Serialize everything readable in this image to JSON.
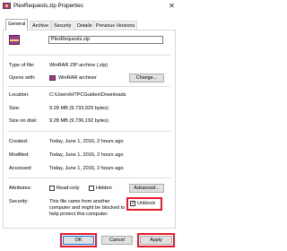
{
  "window": {
    "title": "PlexRequests.zip Properties",
    "close_symbol": "✕"
  },
  "tabs": [
    {
      "label": "General",
      "active": true
    },
    {
      "label": "Archive"
    },
    {
      "label": "Security"
    },
    {
      "label": "Details"
    },
    {
      "label": "Previous Versions"
    }
  ],
  "general": {
    "file_name": "PlexRequests.zip",
    "type_label": "Type of file:",
    "type_value": "WinRAR ZIP archive (.zip)",
    "opens_label": "Opens with:",
    "opens_value": "WinRAR archiver",
    "change_button": "Change...",
    "location_label": "Location:",
    "location_value": "C:\\Users\\HTPCGuides\\Downloads",
    "size_label": "Size:",
    "size_value": "9.28 MB (9,733,929 bytes)",
    "size_on_disk_label": "Size on disk:",
    "size_on_disk_value": "9.28 MB (9,736,192 bytes)",
    "created_label": "Created:",
    "created_value": "Today, June 1, 2016, 2 hours ago",
    "modified_label": "Modified:",
    "modified_value": "Today, June 1, 2016, 2 hours ago",
    "accessed_label": "Accessed:",
    "accessed_value": "Today, June 1, 2016, 2 hours ago",
    "attributes_label": "Attributes:",
    "readonly_label": "Read-only",
    "hidden_label": "Hidden",
    "advanced_button": "Advanced...",
    "security_label": "Security:",
    "security_text_1": "This file came from another",
    "security_text_2": "computer and might be blocked to",
    "security_text_3": "help protect this computer.",
    "unblock_label": "Unblock",
    "unblock_checked": true,
    "unblock_mark": "✓"
  },
  "buttons": {
    "ok": "OK",
    "cancel": "Cancel",
    "apply": "Apply"
  },
  "colors": {
    "highlight": "#e8192c",
    "winrar_purple": "#a03d8a"
  },
  "icons": {
    "title": "winrar-archive-icon",
    "file": "winrar-archive-icon",
    "close": "close-icon"
  }
}
